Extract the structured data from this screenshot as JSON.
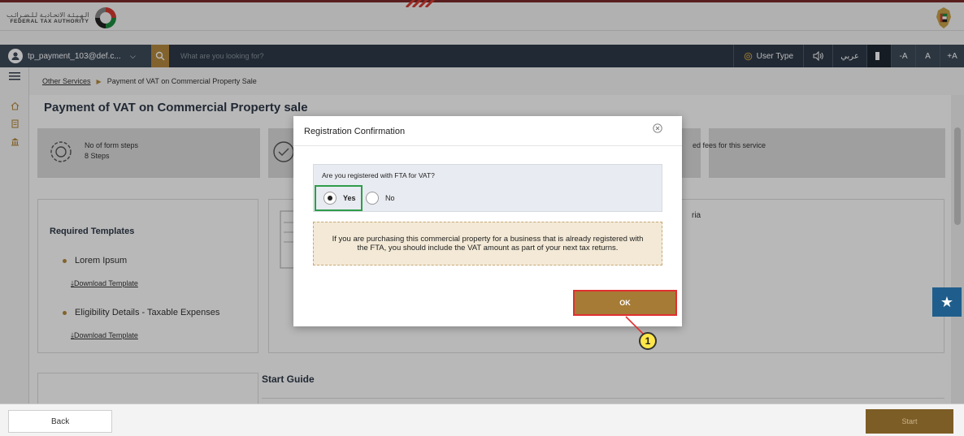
{
  "header": {
    "logo_ar": "الـهـيـئـة الاتحـاديـة لـلـضـرائـب",
    "logo_en": "FEDERAL TAX AUTHORITY"
  },
  "navbar": {
    "user_name": "tp_payment_103@def.c...",
    "search_placeholder": "What are you looking for?",
    "user_type_label": "User Type",
    "language_label": "عربي",
    "font_decrease": "-A",
    "font_normal": "A",
    "font_increase": "+A"
  },
  "breadcrumb": {
    "parent": "Other Services",
    "current": "Payment of VAT on Commercial Property Sale"
  },
  "page": {
    "title": "Payment of VAT on Commercial Property sale",
    "steps_label": "No of form steps",
    "steps_value": "8 Steps",
    "fees_text": "ed fees for this service",
    "criteria_text": "ria"
  },
  "templates": {
    "title": "Required Templates",
    "items": [
      {
        "name": "Lorem Ipsum",
        "download": "Download Template"
      },
      {
        "name": "Eligibility Details - Taxable Expenses",
        "download": "Download Template"
      }
    ]
  },
  "start_guide": "Start Guide",
  "dialog": {
    "title": "Registration Confirmation",
    "question": "Are you registered with FTA for VAT?",
    "option_yes": "Yes",
    "option_no": "No",
    "selected": "Yes",
    "notice": "If you are purchasing this commercial property for a business that is already registered with the FTA, you should include the VAT amount as part of your next tax returns.",
    "ok_label": "OK"
  },
  "callout": {
    "number": "1"
  },
  "footer": {
    "back_label": "Back",
    "start_label": "Start"
  },
  "colors": {
    "accent": "#b68a3f",
    "nav_bg": "#2f3a48",
    "ok_button": "#a57b35",
    "highlight_green": "#2e9d4a",
    "highlight_red": "#e03030",
    "star_button": "#1f5e8c"
  }
}
